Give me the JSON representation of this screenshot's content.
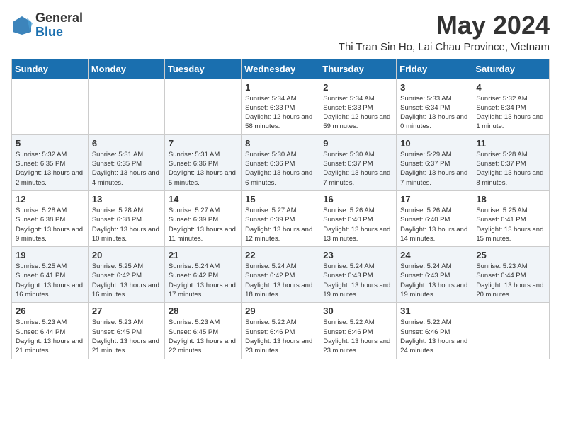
{
  "header": {
    "logo_general": "General",
    "logo_blue": "Blue",
    "month_title": "May 2024",
    "location": "Thi Tran Sin Ho, Lai Chau Province, Vietnam"
  },
  "weekdays": [
    "Sunday",
    "Monday",
    "Tuesday",
    "Wednesday",
    "Thursday",
    "Friday",
    "Saturday"
  ],
  "weeks": [
    [
      {
        "day": "",
        "sunrise": "",
        "sunset": "",
        "daylight": ""
      },
      {
        "day": "",
        "sunrise": "",
        "sunset": "",
        "daylight": ""
      },
      {
        "day": "",
        "sunrise": "",
        "sunset": "",
        "daylight": ""
      },
      {
        "day": "1",
        "sunrise": "Sunrise: 5:34 AM",
        "sunset": "Sunset: 6:33 PM",
        "daylight": "Daylight: 12 hours and 58 minutes."
      },
      {
        "day": "2",
        "sunrise": "Sunrise: 5:34 AM",
        "sunset": "Sunset: 6:33 PM",
        "daylight": "Daylight: 12 hours and 59 minutes."
      },
      {
        "day": "3",
        "sunrise": "Sunrise: 5:33 AM",
        "sunset": "Sunset: 6:34 PM",
        "daylight": "Daylight: 13 hours and 0 minutes."
      },
      {
        "day": "4",
        "sunrise": "Sunrise: 5:32 AM",
        "sunset": "Sunset: 6:34 PM",
        "daylight": "Daylight: 13 hours and 1 minute."
      }
    ],
    [
      {
        "day": "5",
        "sunrise": "Sunrise: 5:32 AM",
        "sunset": "Sunset: 6:35 PM",
        "daylight": "Daylight: 13 hours and 2 minutes."
      },
      {
        "day": "6",
        "sunrise": "Sunrise: 5:31 AM",
        "sunset": "Sunset: 6:35 PM",
        "daylight": "Daylight: 13 hours and 4 minutes."
      },
      {
        "day": "7",
        "sunrise": "Sunrise: 5:31 AM",
        "sunset": "Sunset: 6:36 PM",
        "daylight": "Daylight: 13 hours and 5 minutes."
      },
      {
        "day": "8",
        "sunrise": "Sunrise: 5:30 AM",
        "sunset": "Sunset: 6:36 PM",
        "daylight": "Daylight: 13 hours and 6 minutes."
      },
      {
        "day": "9",
        "sunrise": "Sunrise: 5:30 AM",
        "sunset": "Sunset: 6:37 PM",
        "daylight": "Daylight: 13 hours and 7 minutes."
      },
      {
        "day": "10",
        "sunrise": "Sunrise: 5:29 AM",
        "sunset": "Sunset: 6:37 PM",
        "daylight": "Daylight: 13 hours and 7 minutes."
      },
      {
        "day": "11",
        "sunrise": "Sunrise: 5:28 AM",
        "sunset": "Sunset: 6:37 PM",
        "daylight": "Daylight: 13 hours and 8 minutes."
      }
    ],
    [
      {
        "day": "12",
        "sunrise": "Sunrise: 5:28 AM",
        "sunset": "Sunset: 6:38 PM",
        "daylight": "Daylight: 13 hours and 9 minutes."
      },
      {
        "day": "13",
        "sunrise": "Sunrise: 5:28 AM",
        "sunset": "Sunset: 6:38 PM",
        "daylight": "Daylight: 13 hours and 10 minutes."
      },
      {
        "day": "14",
        "sunrise": "Sunrise: 5:27 AM",
        "sunset": "Sunset: 6:39 PM",
        "daylight": "Daylight: 13 hours and 11 minutes."
      },
      {
        "day": "15",
        "sunrise": "Sunrise: 5:27 AM",
        "sunset": "Sunset: 6:39 PM",
        "daylight": "Daylight: 13 hours and 12 minutes."
      },
      {
        "day": "16",
        "sunrise": "Sunrise: 5:26 AM",
        "sunset": "Sunset: 6:40 PM",
        "daylight": "Daylight: 13 hours and 13 minutes."
      },
      {
        "day": "17",
        "sunrise": "Sunrise: 5:26 AM",
        "sunset": "Sunset: 6:40 PM",
        "daylight": "Daylight: 13 hours and 14 minutes."
      },
      {
        "day": "18",
        "sunrise": "Sunrise: 5:25 AM",
        "sunset": "Sunset: 6:41 PM",
        "daylight": "Daylight: 13 hours and 15 minutes."
      }
    ],
    [
      {
        "day": "19",
        "sunrise": "Sunrise: 5:25 AM",
        "sunset": "Sunset: 6:41 PM",
        "daylight": "Daylight: 13 hours and 16 minutes."
      },
      {
        "day": "20",
        "sunrise": "Sunrise: 5:25 AM",
        "sunset": "Sunset: 6:42 PM",
        "daylight": "Daylight: 13 hours and 16 minutes."
      },
      {
        "day": "21",
        "sunrise": "Sunrise: 5:24 AM",
        "sunset": "Sunset: 6:42 PM",
        "daylight": "Daylight: 13 hours and 17 minutes."
      },
      {
        "day": "22",
        "sunrise": "Sunrise: 5:24 AM",
        "sunset": "Sunset: 6:42 PM",
        "daylight": "Daylight: 13 hours and 18 minutes."
      },
      {
        "day": "23",
        "sunrise": "Sunrise: 5:24 AM",
        "sunset": "Sunset: 6:43 PM",
        "daylight": "Daylight: 13 hours and 19 minutes."
      },
      {
        "day": "24",
        "sunrise": "Sunrise: 5:24 AM",
        "sunset": "Sunset: 6:43 PM",
        "daylight": "Daylight: 13 hours and 19 minutes."
      },
      {
        "day": "25",
        "sunrise": "Sunrise: 5:23 AM",
        "sunset": "Sunset: 6:44 PM",
        "daylight": "Daylight: 13 hours and 20 minutes."
      }
    ],
    [
      {
        "day": "26",
        "sunrise": "Sunrise: 5:23 AM",
        "sunset": "Sunset: 6:44 PM",
        "daylight": "Daylight: 13 hours and 21 minutes."
      },
      {
        "day": "27",
        "sunrise": "Sunrise: 5:23 AM",
        "sunset": "Sunset: 6:45 PM",
        "daylight": "Daylight: 13 hours and 21 minutes."
      },
      {
        "day": "28",
        "sunrise": "Sunrise: 5:23 AM",
        "sunset": "Sunset: 6:45 PM",
        "daylight": "Daylight: 13 hours and 22 minutes."
      },
      {
        "day": "29",
        "sunrise": "Sunrise: 5:22 AM",
        "sunset": "Sunset: 6:46 PM",
        "daylight": "Daylight: 13 hours and 23 minutes."
      },
      {
        "day": "30",
        "sunrise": "Sunrise: 5:22 AM",
        "sunset": "Sunset: 6:46 PM",
        "daylight": "Daylight: 13 hours and 23 minutes."
      },
      {
        "day": "31",
        "sunrise": "Sunrise: 5:22 AM",
        "sunset": "Sunset: 6:46 PM",
        "daylight": "Daylight: 13 hours and 24 minutes."
      },
      {
        "day": "",
        "sunrise": "",
        "sunset": "",
        "daylight": ""
      }
    ]
  ]
}
